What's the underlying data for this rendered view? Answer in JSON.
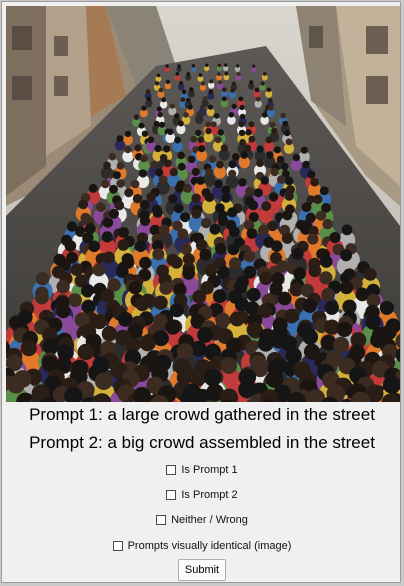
{
  "image": {
    "description_icon": "crowd-photo"
  },
  "prompts": {
    "prompt1": "Prompt 1: a large crowd gathered in the street",
    "prompt2": "Prompt 2: a big crowd assembled in the street"
  },
  "options": [
    {
      "label": "Is Prompt 1",
      "checked": false
    },
    {
      "label": "Is Prompt 2",
      "checked": false
    },
    {
      "label": "Neither / Wrong",
      "checked": false
    },
    {
      "label": "Prompts visually identical (image)",
      "checked": false
    }
  ],
  "submit_label": "Submit"
}
